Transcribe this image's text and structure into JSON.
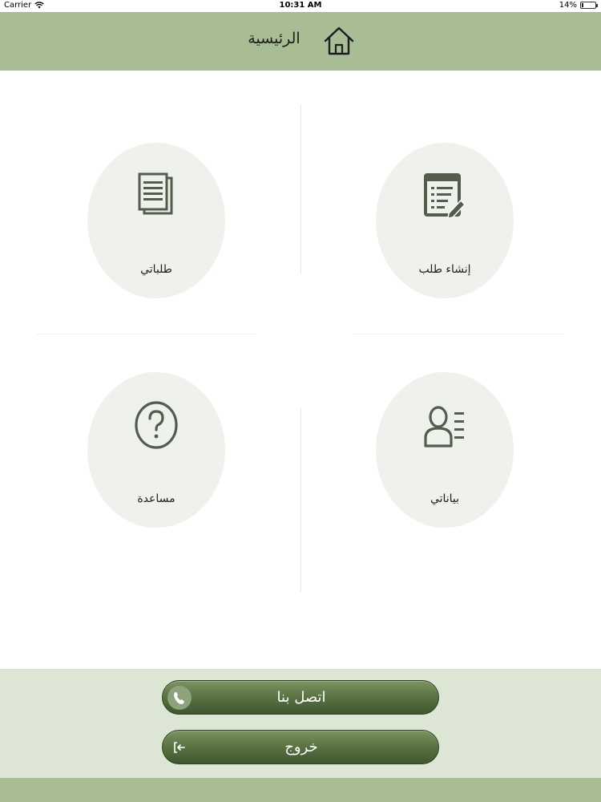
{
  "status_bar": {
    "carrier": "Carrier",
    "time": "10:31 AM",
    "battery_text": "14%",
    "battery_level": 0.14
  },
  "header": {
    "title": "الرئيسية",
    "icon": "home-icon"
  },
  "tiles": [
    {
      "label": "إنشاء طلب",
      "icon": "create-request-icon"
    },
    {
      "label": "طلباتي",
      "icon": "documents-icon"
    },
    {
      "label": "بياناتي",
      "icon": "profile-list-icon"
    },
    {
      "label": "مساعدة",
      "icon": "help-icon"
    }
  ],
  "footer": {
    "contact_label": "اتصل بنا",
    "contact_icon": "phone-icon",
    "logout_label": "خروج",
    "logout_icon": "logout-icon"
  },
  "colors": {
    "header_bg": "#a9bd94",
    "footer_bg": "#dde6d5",
    "tile_bg": "#eff1ec",
    "icon_color": "#555c4c",
    "button_dark": "#4a6338"
  }
}
